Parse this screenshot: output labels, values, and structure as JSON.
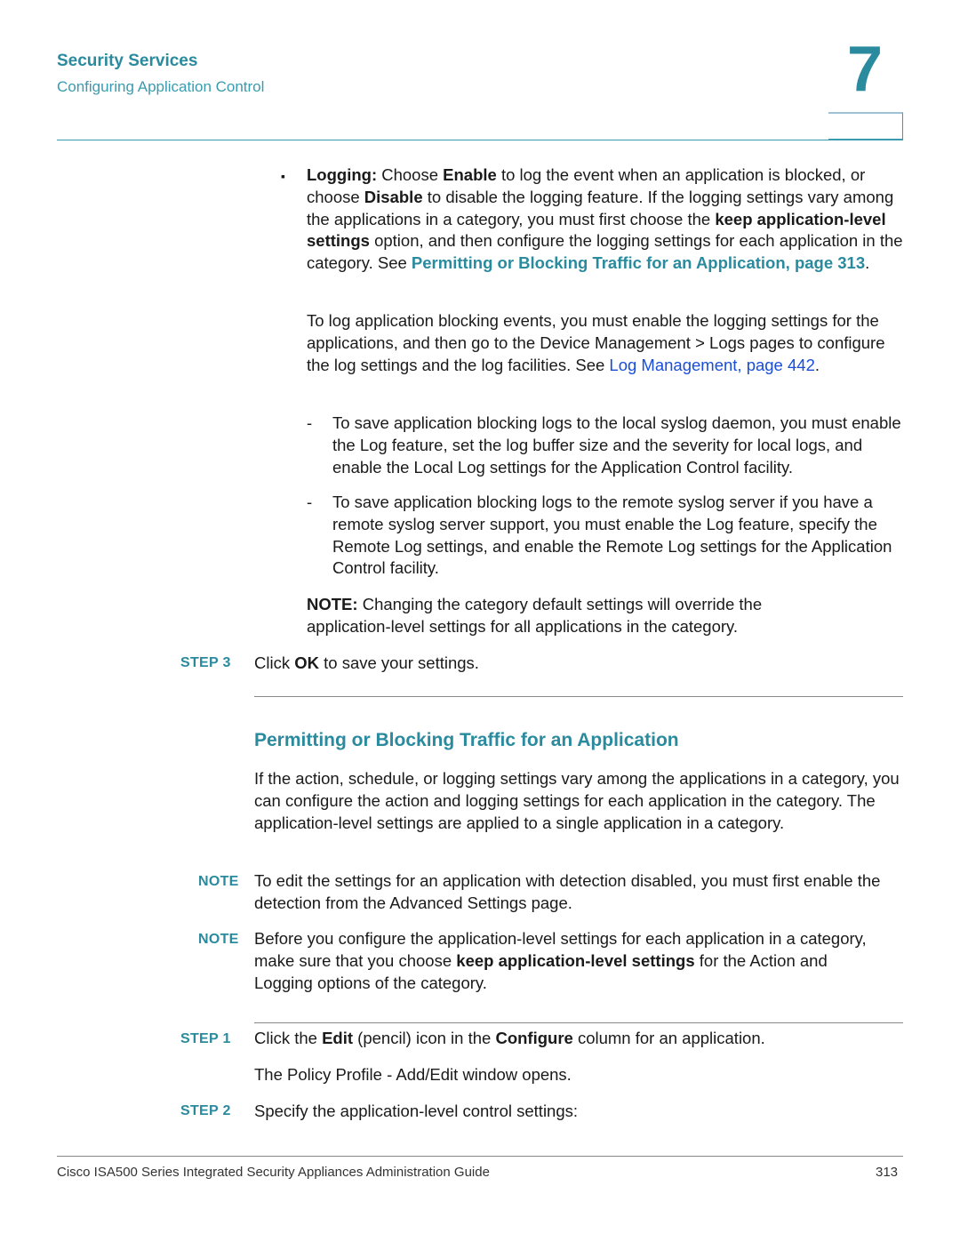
{
  "header": {
    "chapter_title": "Security Services",
    "section_title": "Configuring Application Control",
    "chapter_number": "7"
  },
  "logging_bullet": {
    "label": "Logging:",
    "t1": " Choose ",
    "enable": "Enable",
    "t2": " to log the event when an application is blocked, or choose ",
    "disable": "Disable",
    "t3": " to disable the logging feature. If the logging settings vary among the applications in a category, you must first choose the ",
    "keep": "keep application-level settings",
    "t4": " option, and then configure the logging settings for each application in the category. See ",
    "link": "Permitting or Blocking Traffic for an Application, page 313",
    "t5": "."
  },
  "log_para": {
    "t1": "To log application blocking events, you must enable the logging settings for the applications, and then go to the Device Management > Logs pages to configure the log settings and the log facilities. See ",
    "link": "Log Management, page 442",
    "t2": "."
  },
  "dash_items": [
    "To save application blocking logs to the local syslog daemon, you must enable the Log feature, set the log buffer size and the severity for local logs, and enable the Local Log settings for the Application Control facility.",
    "To save application blocking logs to the remote syslog server if you have a remote syslog server support, you must enable the Log feature, specify the Remote Log settings, and enable the Remote Log settings for the Application Control facility."
  ],
  "inline_note": {
    "label": "NOTE:",
    "text": " Changing the category default settings will override the application-level settings for all applications in the category."
  },
  "step3": {
    "label": "STEP 3",
    "t1": "Click ",
    "ok": "OK",
    "t2": " to save your settings."
  },
  "section_heading": "Permitting or Blocking Traffic for an Application",
  "intro": "If the action, schedule, or logging settings vary among the applications in a category, you can configure the action and logging settings for each application in the category. The application-level settings are applied to a single application in a category.",
  "notes": [
    {
      "label": "NOTE",
      "text": "To edit the settings for an application with detection disabled, you must first enable the detection from the Advanced Settings page."
    },
    {
      "label": "NOTE",
      "t1": "Before you configure the application-level settings for each application in a category, make sure that you choose ",
      "bold": "keep application-level settings",
      "t2": " for the Action and Logging options of the category."
    }
  ],
  "step1": {
    "label": "STEP 1",
    "t1": "Click the ",
    "edit": "Edit",
    "t2": " (pencil) icon in the ",
    "configure": "Configure",
    "t3": " column for an application.",
    "result": "The Policy Profile - Add/Edit window opens."
  },
  "step2": {
    "label": "STEP 2",
    "text": "Specify the application-level control settings:"
  },
  "footer": {
    "title": "Cisco ISA500 Series Integrated Security Appliances Administration Guide",
    "page": "313"
  }
}
